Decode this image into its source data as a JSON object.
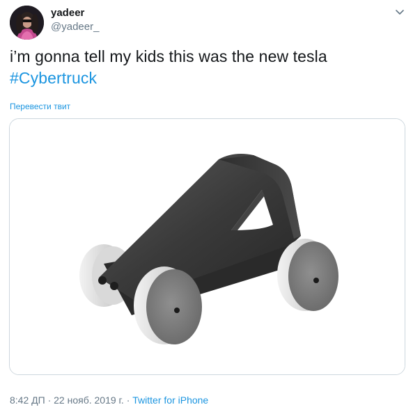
{
  "user": {
    "display_name": "yadeer",
    "handle": "@yadeer_"
  },
  "tweet": {
    "text": "i’m gonna tell my kids this was the new tesla",
    "hashtag": "#Cybertruck",
    "translate_label": "Перевести твит",
    "time": "8:42 ДП",
    "separator_1": " · ",
    "date": "22 нояб. 2019 г.",
    "separator_2": " · ",
    "source": "Twitter for iPhone"
  },
  "media": {
    "alt_subject": "wooden toy car"
  },
  "icons": {
    "menu": "chevron-down-icon"
  },
  "colors": {
    "link": "#1b95e0",
    "secondary_text": "#657786",
    "primary_text": "#14171a",
    "border": "#ccd6dd"
  }
}
